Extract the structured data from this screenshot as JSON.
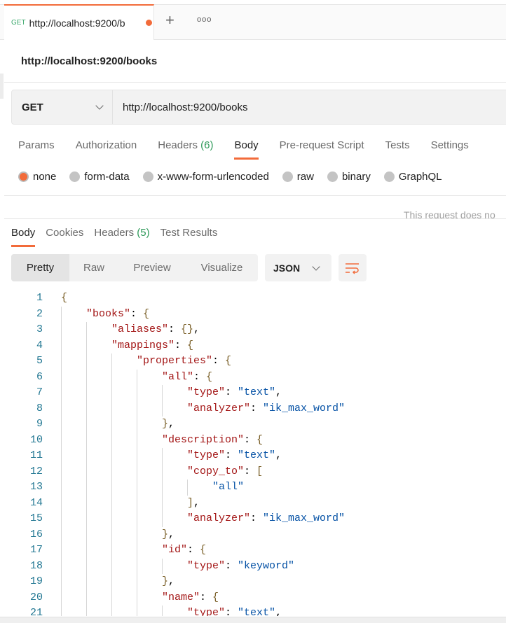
{
  "tab": {
    "method": "GET",
    "url": "http://localhost:9200/b",
    "unsaved": true,
    "new_tab": "+",
    "more": "ooo"
  },
  "request": {
    "title": "http://localhost:9200/books",
    "method": "GET",
    "url": "http://localhost:9200/books"
  },
  "request_tabs": [
    {
      "label": "Params"
    },
    {
      "label": "Authorization"
    },
    {
      "label": "Headers",
      "count": "(6)"
    },
    {
      "label": "Body",
      "active": true
    },
    {
      "label": "Pre-request Script"
    },
    {
      "label": "Tests"
    },
    {
      "label": "Settings"
    }
  ],
  "body_types": [
    {
      "label": "none",
      "selected": true
    },
    {
      "label": "form-data"
    },
    {
      "label": "x-www-form-urlencoded"
    },
    {
      "label": "raw"
    },
    {
      "label": "binary"
    },
    {
      "label": "GraphQL"
    }
  ],
  "notice": "This request does no",
  "response_tabs": [
    {
      "label": "Body",
      "active": true
    },
    {
      "label": "Cookies"
    },
    {
      "label": "Headers",
      "count": "(5)"
    },
    {
      "label": "Test Results"
    }
  ],
  "view_modes": [
    {
      "label": "Pretty",
      "active": true
    },
    {
      "label": "Raw"
    },
    {
      "label": "Preview"
    },
    {
      "label": "Visualize"
    }
  ],
  "format": "JSON",
  "colors": {
    "accent": "#f26b3a",
    "key": "#a31515",
    "string": "#0451a5",
    "line_number": "#237893"
  },
  "code_lines": [
    {
      "n": "1",
      "i": 0,
      "t": [
        [
          "{",
          "b"
        ]
      ]
    },
    {
      "n": "2",
      "i": 1,
      "t": [
        [
          "\"books\"",
          "k"
        ],
        [
          ": ",
          "p"
        ],
        [
          "{",
          "b"
        ]
      ]
    },
    {
      "n": "3",
      "i": 2,
      "t": [
        [
          "\"aliases\"",
          "k"
        ],
        [
          ": ",
          "p"
        ],
        [
          "{}",
          "b"
        ],
        [
          ",",
          "p"
        ]
      ]
    },
    {
      "n": "4",
      "i": 2,
      "t": [
        [
          "\"mappings\"",
          "k"
        ],
        [
          ": ",
          "p"
        ],
        [
          "{",
          "b"
        ]
      ]
    },
    {
      "n": "5",
      "i": 3,
      "t": [
        [
          "\"properties\"",
          "k"
        ],
        [
          ": ",
          "p"
        ],
        [
          "{",
          "b"
        ]
      ]
    },
    {
      "n": "6",
      "i": 4,
      "t": [
        [
          "\"all\"",
          "k"
        ],
        [
          ": ",
          "p"
        ],
        [
          "{",
          "b"
        ]
      ]
    },
    {
      "n": "7",
      "i": 5,
      "t": [
        [
          "\"type\"",
          "k"
        ],
        [
          ": ",
          "p"
        ],
        [
          "\"text\"",
          "s"
        ],
        [
          ",",
          "p"
        ]
      ]
    },
    {
      "n": "8",
      "i": 5,
      "t": [
        [
          "\"analyzer\"",
          "k"
        ],
        [
          ": ",
          "p"
        ],
        [
          "\"ik_max_word\"",
          "s"
        ]
      ]
    },
    {
      "n": "9",
      "i": 4,
      "t": [
        [
          "}",
          "b"
        ],
        [
          ",",
          "p"
        ]
      ]
    },
    {
      "n": "10",
      "i": 4,
      "t": [
        [
          "\"description\"",
          "k"
        ],
        [
          ": ",
          "p"
        ],
        [
          "{",
          "b"
        ]
      ]
    },
    {
      "n": "11",
      "i": 5,
      "t": [
        [
          "\"type\"",
          "k"
        ],
        [
          ": ",
          "p"
        ],
        [
          "\"text\"",
          "s"
        ],
        [
          ",",
          "p"
        ]
      ]
    },
    {
      "n": "12",
      "i": 5,
      "t": [
        [
          "\"copy_to\"",
          "k"
        ],
        [
          ": ",
          "p"
        ],
        [
          "[",
          "b"
        ]
      ]
    },
    {
      "n": "13",
      "i": 6,
      "t": [
        [
          "\"all\"",
          "s"
        ]
      ]
    },
    {
      "n": "14",
      "i": 5,
      "t": [
        [
          "]",
          "b"
        ],
        [
          ",",
          "p"
        ]
      ]
    },
    {
      "n": "15",
      "i": 5,
      "t": [
        [
          "\"analyzer\"",
          "k"
        ],
        [
          ": ",
          "p"
        ],
        [
          "\"ik_max_word\"",
          "s"
        ]
      ]
    },
    {
      "n": "16",
      "i": 4,
      "t": [
        [
          "}",
          "b"
        ],
        [
          ",",
          "p"
        ]
      ]
    },
    {
      "n": "17",
      "i": 4,
      "t": [
        [
          "\"id\"",
          "k"
        ],
        [
          ": ",
          "p"
        ],
        [
          "{",
          "b"
        ]
      ]
    },
    {
      "n": "18",
      "i": 5,
      "t": [
        [
          "\"type\"",
          "k"
        ],
        [
          ": ",
          "p"
        ],
        [
          "\"keyword\"",
          "s"
        ]
      ]
    },
    {
      "n": "19",
      "i": 4,
      "t": [
        [
          "}",
          "b"
        ],
        [
          ",",
          "p"
        ]
      ]
    },
    {
      "n": "20",
      "i": 4,
      "t": [
        [
          "\"name\"",
          "k"
        ],
        [
          ": ",
          "p"
        ],
        [
          "{",
          "b"
        ]
      ]
    },
    {
      "n": "21",
      "i": 5,
      "t": [
        [
          "\"type\"",
          "k"
        ],
        [
          ": ",
          "p"
        ],
        [
          "\"text\"",
          "s"
        ],
        [
          ",",
          "p"
        ]
      ]
    }
  ]
}
